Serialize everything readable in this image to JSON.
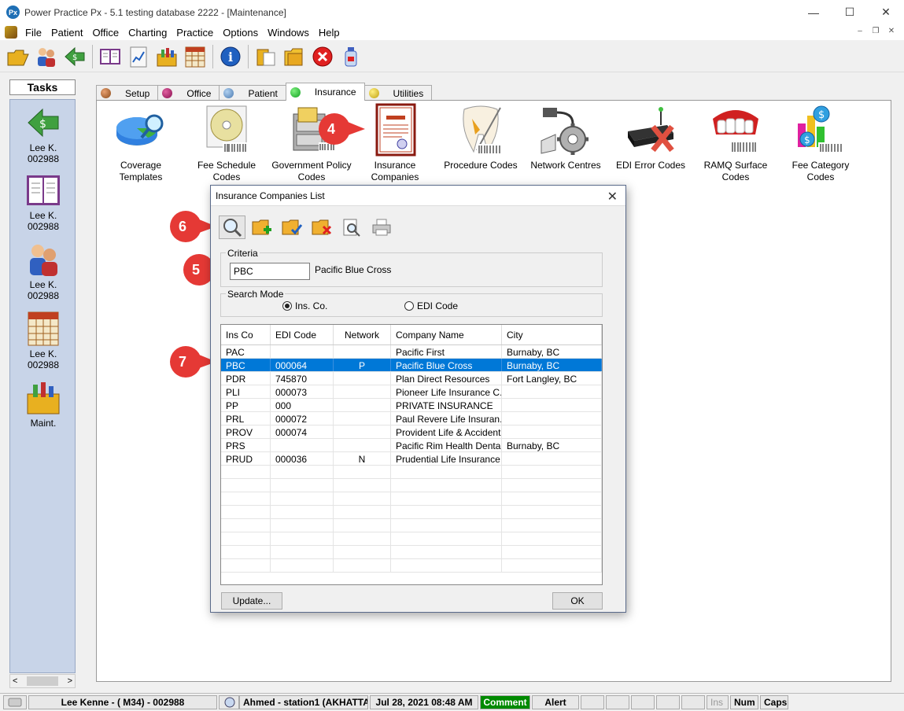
{
  "window": {
    "title": "Power Practice Px - 5.1 testing database 2222 - [Maintenance]",
    "logo_text": "Px",
    "minimize": "—",
    "maximize": "☐",
    "close": "✕"
  },
  "menu": {
    "items": [
      "File",
      "Patient",
      "Office",
      "Charting",
      "Practice",
      "Options",
      "Windows",
      "Help"
    ],
    "mdi_minimize": "–",
    "mdi_restore": "❐",
    "mdi_close": "✕"
  },
  "tasks": {
    "header": "Tasks",
    "items": [
      {
        "line1": "Lee K.",
        "line2": "002988",
        "icon": "money-transfer-icon"
      },
      {
        "line1": "Lee K.",
        "line2": "002988",
        "icon": "ledger-book-icon"
      },
      {
        "line1": "Lee K.",
        "line2": "002988",
        "icon": "patients-icon"
      },
      {
        "line1": "Lee K.",
        "line2": "002988",
        "icon": "chart-icon"
      },
      {
        "line1": "Maint.",
        "line2": "",
        "icon": "toolbox-icon"
      }
    ],
    "scroll_left": "<",
    "scroll_right": ">"
  },
  "tabs": [
    {
      "label": "Setup",
      "color": "#8a4a1a"
    },
    {
      "label": "Office",
      "color": "#8a1050"
    },
    {
      "label": "Patient",
      "color": "#4a7ab0"
    },
    {
      "label": "Insurance",
      "color": "#10a020"
    },
    {
      "label": "Utilities",
      "color": "#e0c010"
    }
  ],
  "insurance_items": [
    {
      "line1": "Coverage",
      "line2": "Templates"
    },
    {
      "line1": "Fee Schedule",
      "line2": "Codes"
    },
    {
      "line1": "Government Policy",
      "line2": "Codes"
    },
    {
      "line1": "Insurance",
      "line2": "Companies"
    },
    {
      "line1": "Procedure Codes",
      "line2": ""
    },
    {
      "line1": "Network Centres",
      "line2": ""
    },
    {
      "line1": "EDI Error Codes",
      "line2": ""
    },
    {
      "line1": "RAMQ Surface",
      "line2": "Codes"
    },
    {
      "line1": "Fee Category",
      "line2": "Codes"
    }
  ],
  "callouts": {
    "c4": "4",
    "c5": "5",
    "c6": "6",
    "c7": "7",
    "color": "#e53935"
  },
  "dialog": {
    "title": "Insurance Companies List",
    "close": "✕",
    "criteria_label": "Criteria",
    "criteria_value": "PBC",
    "criteria_result": "Pacific Blue Cross",
    "search_mode_label": "Search Mode",
    "mode_ins": "Ins. Co.",
    "mode_edi": "EDI Code",
    "columns": [
      "Ins Co",
      "EDI Code",
      "Network",
      "Company Name",
      "City"
    ],
    "rows": [
      [
        "PAC",
        "",
        "",
        "Pacific First",
        "Burnaby, BC"
      ],
      [
        "PBC",
        "000064",
        "P",
        "Pacific Blue Cross",
        "Burnaby, BC"
      ],
      [
        "PDR",
        "745870",
        "",
        "Plan Direct Resources",
        "Fort Langley, BC"
      ],
      [
        "PLI",
        "000073",
        "",
        "Pioneer Life Insurance C...",
        ""
      ],
      [
        "PP",
        "000",
        "",
        "PRIVATE INSURANCE",
        ""
      ],
      [
        "PRL",
        "000072",
        "",
        "Paul Revere Life Insuran...",
        ""
      ],
      [
        "PROV",
        "000074",
        "",
        "Provident Life & Accident...",
        ""
      ],
      [
        "PRS",
        "",
        "",
        "Pacific Rim Health Denta...",
        "Burnaby, BC"
      ],
      [
        "PRUD",
        "000036",
        "N",
        "Prudential Life Insurance ...",
        ""
      ]
    ],
    "selected_row": 1,
    "update_button": "Update...",
    "ok_button": "OK"
  },
  "status": {
    "user": "Lee Kenne - ( M34) - 002988",
    "station": "Ahmed - station1 (AKHATTA",
    "datetime": "Jul 28, 2021 08:48 AM",
    "comment": "Comment",
    "alert": "Alert",
    "ins": "Ins",
    "num": "Num",
    "caps": "Caps"
  }
}
